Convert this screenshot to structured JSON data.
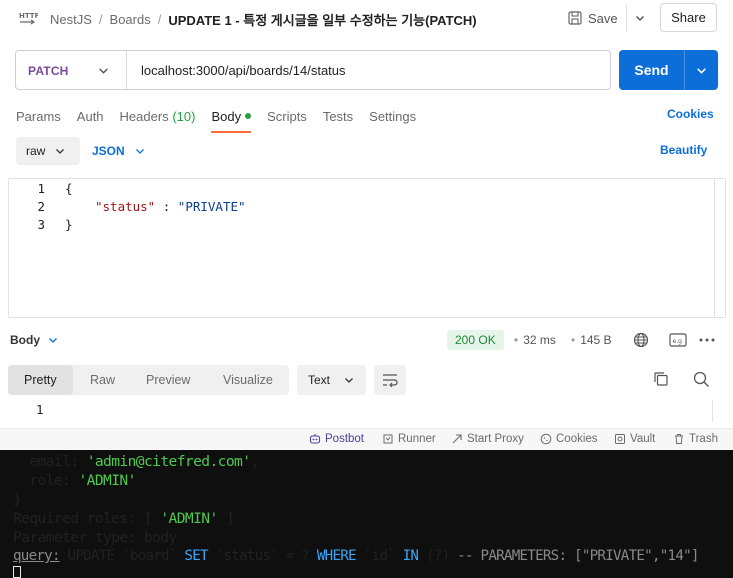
{
  "header": {
    "icon": "http-icon",
    "breadcrumb": [
      "NestJS",
      "Boards"
    ],
    "title": "UPDATE 1 - 특정 게시글을 일부 수정하는 기능(PATCH)",
    "save_label": "Save",
    "share_label": "Share"
  },
  "request": {
    "method": "PATCH",
    "url": "localhost:3000/api/boards/14/status",
    "send_label": "Send",
    "method_color": "#7c4a9c",
    "send_color": "#0c6ed9"
  },
  "tabs": {
    "params": "Params",
    "auth": "Auth",
    "headers": "Headers",
    "headers_count": "(10)",
    "body": "Body",
    "scripts": "Scripts",
    "tests": "Tests",
    "settings": "Settings",
    "cookies": "Cookies"
  },
  "body_mode": {
    "raw": "raw",
    "format": "JSON",
    "beautify": "Beautify"
  },
  "editor": {
    "line_numbers": [
      "1",
      "2",
      "3"
    ],
    "open_brace": "{",
    "key": "\"status\"",
    "colon": " : ",
    "value": "\"PRIVATE\"",
    "close_brace": "}"
  },
  "response": {
    "tab": "Body",
    "status": "200 OK",
    "time": "32 ms",
    "size": "145 B",
    "views": [
      "Pretty",
      "Raw",
      "Preview",
      "Visualize"
    ],
    "format": "Text",
    "line_number": "1"
  },
  "footer": {
    "postbot": "Postbot",
    "runner": "Runner",
    "start_proxy": "Start Proxy",
    "cookies": "Cookies",
    "vault": "Vault",
    "trash": "Trash"
  },
  "terminal": {
    "email_key": "  email: ",
    "email_value": "'admin@citefred.com'",
    "email_comma": ",",
    "role_key": "  role: ",
    "role_value": "'ADMIN'",
    "close": "}",
    "roles_prefix": "Required roles: [ ",
    "roles_value": "'ADMIN'",
    "roles_suffix": " ]",
    "param_type": "Parameter type: body",
    "query_label": "query:",
    "q_update": " UPDATE `board` ",
    "q_set": "SET",
    "q_status": " `status` = ? ",
    "q_where": "WHERE",
    "q_id": " `id` ",
    "q_in": "IN",
    "q_rest": " (?) ",
    "q_params": "-- PARAMETERS: [\"PRIVATE\",\"14\"]"
  }
}
